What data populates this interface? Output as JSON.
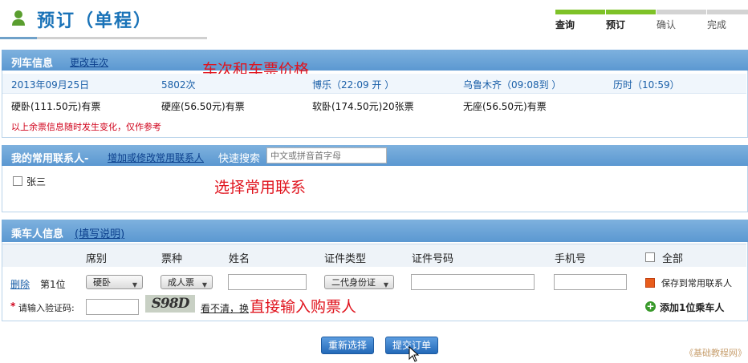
{
  "page": {
    "title": "预订（单程）"
  },
  "steps": [
    {
      "label": "查询",
      "state": "done",
      "bar_color": "#7ec228"
    },
    {
      "label": "预订",
      "state": "current",
      "bar_color": "#7ec228"
    },
    {
      "label": "确认",
      "state": "todo",
      "bar_color": "#d3d3d3"
    },
    {
      "label": "完成",
      "state": "todo",
      "bar_color": "#d3d3d3"
    }
  ],
  "train": {
    "section_title": "列车信息",
    "change_link": "更改车次",
    "annotation": "车次和车票价格",
    "date": "2013年09月25日",
    "train_no": "5802次",
    "depart": "博乐（22:09 开 ）",
    "arrive": "乌鲁木齐（09:08到 ）",
    "duration": "历时（10:59）",
    "seats": [
      "硬卧(111.50元)有票",
      "硬座(56.50元)有票",
      "软卧(174.50元)20张票",
      "无座(56.50元)有票"
    ],
    "note": "以上余票信息随时发生变化，仅作参考"
  },
  "contacts": {
    "section_title": "我的常用联系人-",
    "manage_link": "增加或修改常用联系人",
    "search_label": "快速搜索",
    "search_placeholder": "中文或拼音首字母",
    "annotation": "选择常用联系",
    "items": [
      {
        "name": "张三",
        "checked": false
      }
    ]
  },
  "passenger": {
    "section_title": "乘车人信息",
    "help_link": "(填写说明)",
    "columns": {
      "seat": "席别",
      "ticket": "票种",
      "name": "姓名",
      "id_type": "证件类型",
      "id_no": "证件号码",
      "phone": "手机号",
      "all": "全部"
    },
    "row": {
      "delete": "删除",
      "index": "第1位",
      "seat": "硬卧",
      "ticket": "成人票",
      "id_type": "二代身份证",
      "save_label": "保存到常用联系人",
      "save_checked": true
    },
    "captcha_label": "请输入验证码:",
    "captcha_required": "*",
    "captcha_text": "S98D",
    "refresh_link": "看不清，换",
    "annotation": "直接输入购票人",
    "add_label": "添加1位乘车人"
  },
  "buttons": {
    "reset": "重新选择",
    "submit": "提交订单"
  },
  "watermark": "《基础教程网》"
}
